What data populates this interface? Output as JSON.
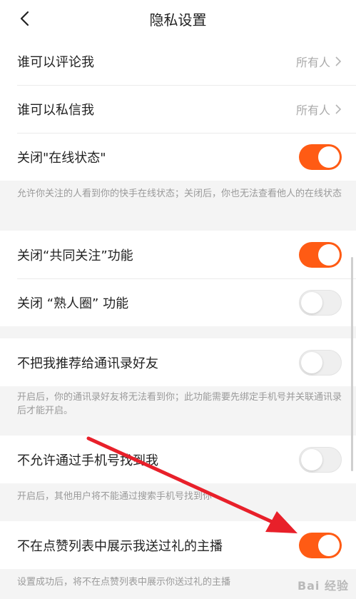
{
  "header": {
    "title": "隐私设置",
    "back_icon": "chevron-left-icon"
  },
  "sections": [
    {
      "rows": [
        {
          "label": "谁可以评论我",
          "value": "所有人"
        },
        {
          "label": "谁可以私信我",
          "value": "所有人"
        },
        {
          "label": "关闭\"在线状态\"",
          "toggle": "on"
        }
      ],
      "note": "允许你关注的人看到你的快手在线状态；关闭后，你也无法查看他人的在线状态"
    },
    {
      "rows": [
        {
          "label": "关闭“共同关注”功能",
          "toggle": "on"
        },
        {
          "label": "关闭 “熟人圈” 功能",
          "toggle": "off"
        }
      ]
    },
    {
      "rows": [
        {
          "label": "不把我推荐给通讯录好友",
          "toggle": "off"
        }
      ],
      "note": "开启后，你的通讯录好友将无法看到你；此功能需要先绑定手机号并关联通讯录后才能开启。"
    },
    {
      "rows": [
        {
          "label": "不允许通过手机号找到我",
          "toggle": "off"
        }
      ],
      "note": "开启后，其他用户将不能通过搜索手机号找到你"
    },
    {
      "rows": [
        {
          "label": "不在点赞列表中展示我送过礼的主播",
          "toggle": "on"
        }
      ],
      "note": "设置成功后，将不在点赞列表中展示你送过礼的主播"
    }
  ],
  "watermark": "Bai 经验",
  "colors": {
    "accent": "#ff5b14",
    "annotation_arrow": "#e8202a"
  }
}
